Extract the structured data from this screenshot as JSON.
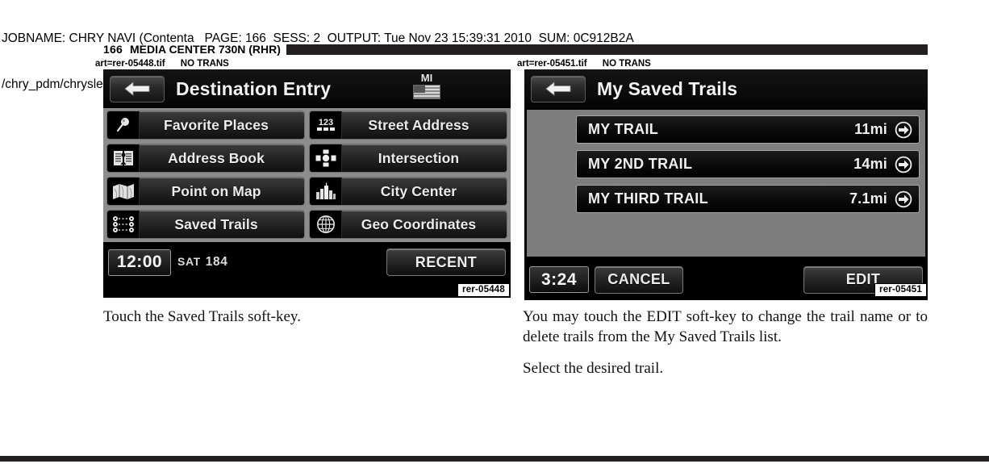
{
  "job_header": {
    "line1": "JOBNAME: CHRY NAVI (Contenta   PAGE: 166  SESS: 2  OUTPUT: Tue Nov 23 15:39:31 2010  SUM: 0C912B2A",
    "line2": "/chry_pdm/chrysler/navi/rhr/navi"
  },
  "banner": {
    "page_number": "166",
    "title": "MEDIA CENTER 730N (RHR)"
  },
  "art_captions": {
    "left": "art=rer-05448.tif      NO TRANS",
    "right": "art=rer-05451.tif      NO TRANS"
  },
  "left_screen": {
    "code": "rer-05448",
    "back_icon": "back-arrow-icon",
    "title": "Destination Entry",
    "state_badge": {
      "label": "MI",
      "icon": "us-flag-icon"
    },
    "softkeys": [
      {
        "label": "Favorite Places",
        "icon": "pin-magnifier-icon"
      },
      {
        "label": "Street Address",
        "icon": "numeric-123-icon"
      },
      {
        "label": "Address Book",
        "icon": "address-book-icon"
      },
      {
        "label": "Intersection",
        "icon": "intersection-icon"
      },
      {
        "label": "Point on Map",
        "icon": "folded-map-icon"
      },
      {
        "label": "City Center",
        "icon": "city-skyline-icon"
      },
      {
        "label": "Saved Trails",
        "icon": "trail-dots-icon"
      },
      {
        "label": "Geo Coordinates",
        "icon": "globe-icon"
      }
    ],
    "status": {
      "clock": "12:00",
      "source": "SAT",
      "channel": "184",
      "recent_label": "RECENT"
    }
  },
  "right_screen": {
    "code": "rer-05451",
    "back_icon": "back-arrow-icon",
    "title": "My Saved Trails",
    "trails": [
      {
        "name": "MY TRAIL",
        "distance": "11mi",
        "icon": "go-arrow-icon"
      },
      {
        "name": "MY 2ND TRAIL",
        "distance": "14mi",
        "icon": "go-arrow-icon"
      },
      {
        "name": "MY THIRD TRAIL",
        "distance": "7.1mi",
        "icon": "go-arrow-icon"
      }
    ],
    "status": {
      "clock": "3:24",
      "cancel_label": "CANCEL",
      "edit_label": "EDIT"
    }
  },
  "body": {
    "left_p1": "Touch the Saved Trails soft-key.",
    "right_p1": "You may touch the EDIT soft-key to change the trail name or to delete trails from the My Saved Trails list.",
    "right_p2": "Select the desired trail."
  },
  "colors": {
    "ink": "#231f20",
    "screen_black": "#000000",
    "panel_gray": "#8c8c8c",
    "list_gray": "#7d7d7d"
  }
}
